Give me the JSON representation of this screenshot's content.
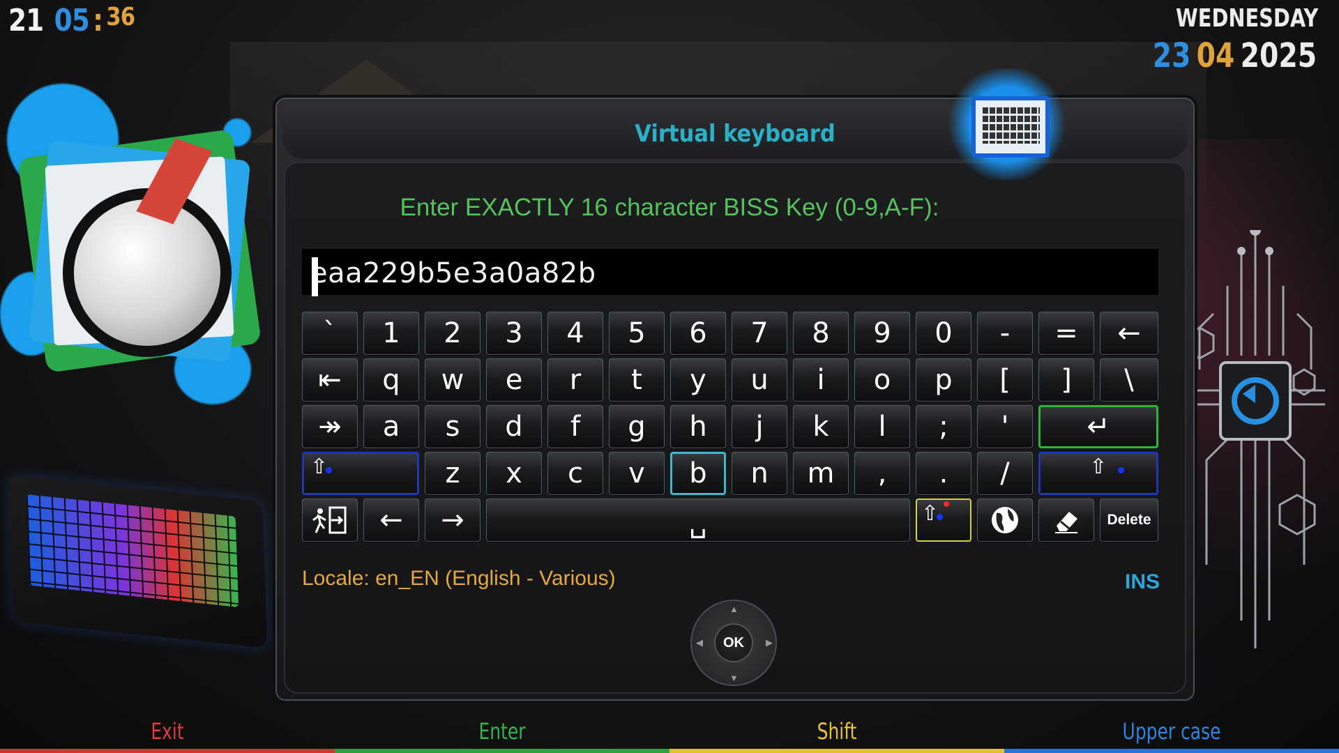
{
  "clock": {
    "hours": "21",
    "minutes": "05",
    "separator": ":",
    "seconds": "36"
  },
  "date": {
    "weekday": "WEDNESDAY",
    "day": "23",
    "month": "04",
    "year": "2025"
  },
  "dialog": {
    "title": "Virtual keyboard",
    "prompt": "Enter EXACTLY 16 character BISS Key (0-9,A-F):",
    "input_value": "eaa229b5e3a0a82b",
    "locale": "Locale: en_EN  (English - Various)",
    "mode": "INS",
    "ok_label": "OK"
  },
  "keys": {
    "row1": [
      "`",
      "1",
      "2",
      "3",
      "4",
      "5",
      "6",
      "7",
      "8",
      "9",
      "0",
      "-",
      "=",
      "←"
    ],
    "row2": [
      "⇤",
      "q",
      "w",
      "e",
      "r",
      "t",
      "y",
      "u",
      "i",
      "o",
      "p",
      "[",
      "]",
      "\\"
    ],
    "row3": [
      "↠",
      "a",
      "s",
      "d",
      "f",
      "g",
      "h",
      "j",
      "k",
      "l",
      ";",
      "'",
      "↵"
    ],
    "row4": [
      "⇧",
      "z",
      "x",
      "c",
      "v",
      "b",
      "n",
      "m",
      ",",
      ".",
      "/",
      "⇧"
    ],
    "row5": [
      "exit",
      "←",
      "→",
      "␣",
      "⇧",
      "globe",
      "eraser",
      "Delete"
    ],
    "selected": "b"
  },
  "footer": [
    {
      "label": "Exit",
      "color": "#e23b3b"
    },
    {
      "label": "Enter",
      "color": "#35b34a"
    },
    {
      "label": "Shift",
      "color": "#e8c23a"
    },
    {
      "label": "Upper case",
      "color": "#2c86de"
    }
  ],
  "colors": {
    "title": "#2bb0c8",
    "prompt": "#57c25c",
    "locale": "#e6a93c",
    "selection": "#3fb9c4"
  }
}
